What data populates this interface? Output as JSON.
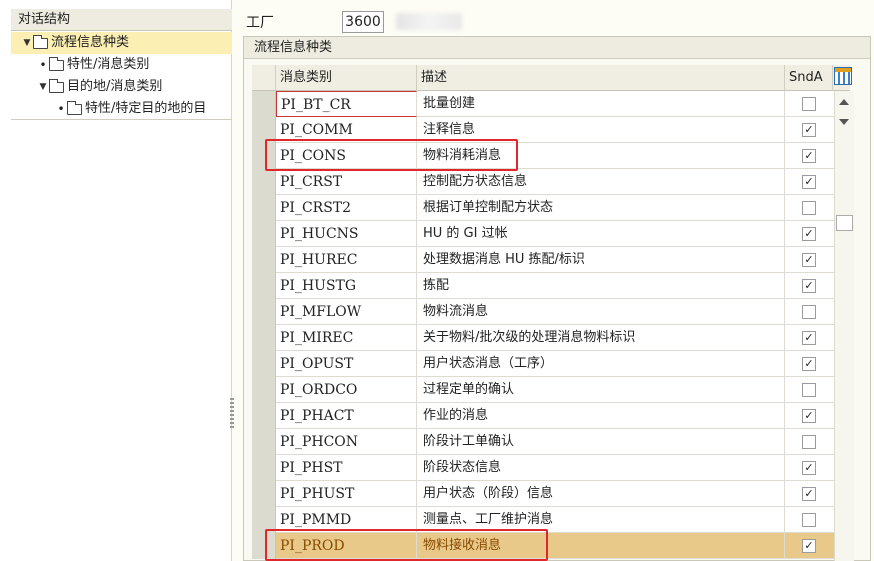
{
  "tree": {
    "header": "对话结构",
    "items": [
      {
        "label": "流程信息种类",
        "level": 0,
        "expanded": true,
        "selected": true
      },
      {
        "label": "特性/消息类别",
        "level": 1,
        "expanded": false,
        "selected": false
      },
      {
        "label": "目的地/消息类别",
        "level": 0,
        "expanded": true,
        "selected": false
      },
      {
        "label": "特性/特定目的地的目",
        "level": 2,
        "expanded": false,
        "selected": false
      }
    ]
  },
  "plant": {
    "label": "工厂",
    "value": "3600"
  },
  "table": {
    "title": "流程信息种类",
    "columns": {
      "code": "消息类别",
      "desc": "描述",
      "snd": "SndA"
    },
    "rows": [
      {
        "code": "PI_BT_CR",
        "desc": "批量创建",
        "checked": false
      },
      {
        "code": "PI_COMM",
        "desc": "注释信息",
        "checked": true
      },
      {
        "code": "PI_CONS",
        "desc": "物料消耗消息",
        "checked": true
      },
      {
        "code": "PI_CRST",
        "desc": "控制配方状态信息",
        "checked": true
      },
      {
        "code": "PI_CRST2",
        "desc": "根据订单控制配方状态",
        "checked": false
      },
      {
        "code": "PI_HUCNS",
        "desc": "HU 的 GI 过帐",
        "checked": true
      },
      {
        "code": "PI_HUREC",
        "desc": "处理数据消息 HU 拣配/标识",
        "checked": true
      },
      {
        "code": "PI_HUSTG",
        "desc": "拣配",
        "checked": true
      },
      {
        "code": "PI_MFLOW",
        "desc": "物料流消息",
        "checked": false
      },
      {
        "code": "PI_MIREC",
        "desc": "关于物料/批次级的处理消息物料标识",
        "checked": true
      },
      {
        "code": "PI_OPUST",
        "desc": "用户状态消息（工序）",
        "checked": true
      },
      {
        "code": "PI_ORDCO",
        "desc": "过程定单的确认",
        "checked": false
      },
      {
        "code": "PI_PHACT",
        "desc": "作业的消息",
        "checked": true
      },
      {
        "code": "PI_PHCON",
        "desc": "阶段计工单确认",
        "checked": false
      },
      {
        "code": "PI_PHST",
        "desc": "阶段状态信息",
        "checked": true
      },
      {
        "code": "PI_PHUST",
        "desc": "用户状态（阶段）信息",
        "checked": true
      },
      {
        "code": "PI_PMMD",
        "desc": "测量点、工厂维护消息",
        "checked": false
      },
      {
        "code": "PI_PROD",
        "desc": "物料接收消息",
        "checked": true
      }
    ]
  },
  "icons": {
    "check": "✓",
    "expanded": "▼",
    "bullet": "•",
    "settings": "table-settings-icon"
  }
}
